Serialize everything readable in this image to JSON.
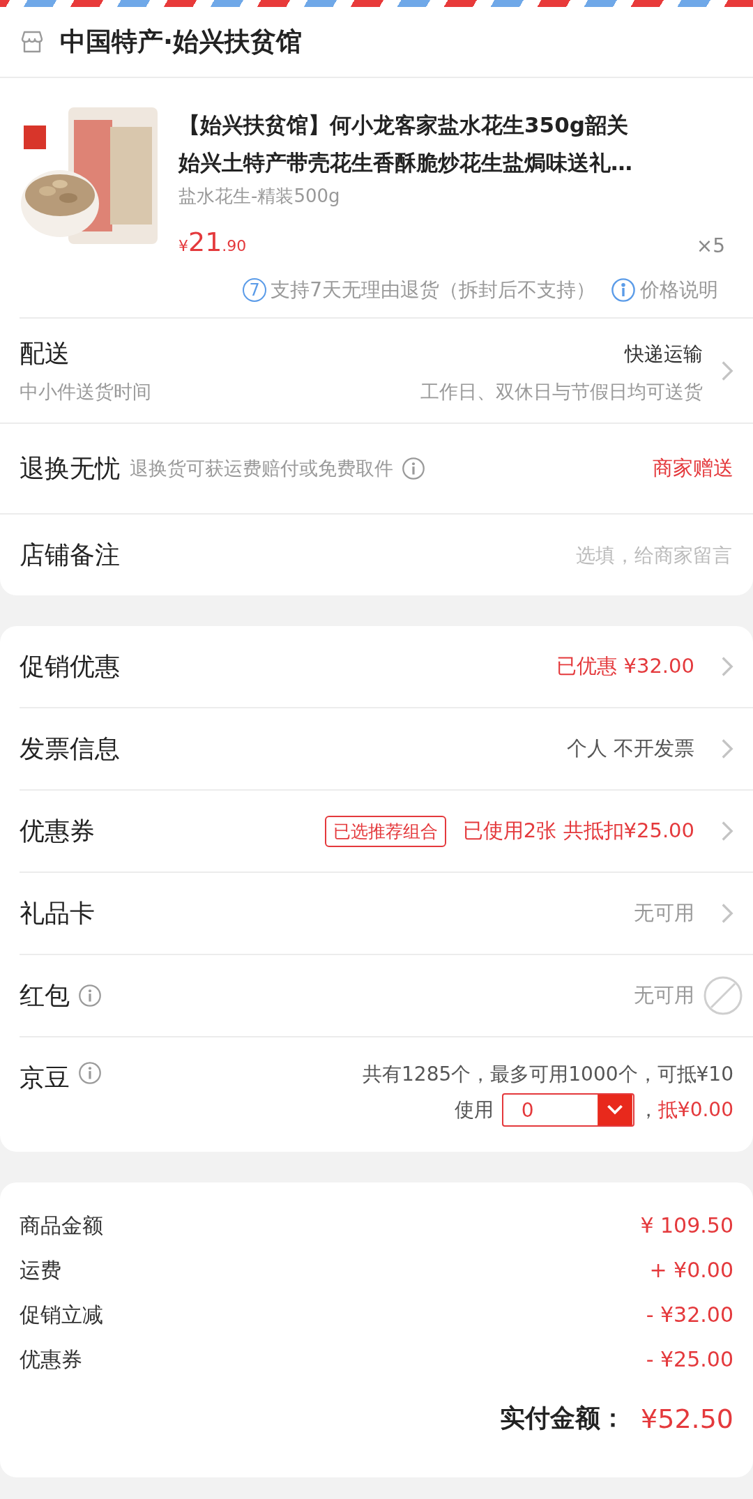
{
  "store": {
    "name": "中国特产·始兴扶贫馆"
  },
  "product": {
    "kind": "picture",
    "title": "【始兴扶贫馆】何小龙客家盐水花生350g韶关始兴土特产带壳花生香酥脆炒花生盐焗味送礼…",
    "spec": "盐水花生-精装500g",
    "price": {
      "currency": "¥",
      "integer": "21",
      "decimal": ".90"
    },
    "quantity": "×5",
    "services": [
      {
        "kind": "badge",
        "badge": "7",
        "text": "支持7天无理由退货（拆封后不支持）"
      },
      {
        "kind": "info",
        "text": "价格说明"
      }
    ]
  },
  "delivery": {
    "title": "配送",
    "subtitle": "中小件送货时间",
    "value": "快递运输",
    "detail": "工作日、双休日与节假日均可送货"
  },
  "returns": {
    "title": "退换无忧",
    "description": "退换货可获运费赔付或免费取件",
    "value": "商家赠送"
  },
  "note": {
    "label": "店铺备注",
    "placeholder": "选填，给商家留言"
  },
  "options": [
    {
      "kind": "arrow",
      "label": "促销优惠",
      "info": false,
      "value": "已优惠 ¥32.00",
      "emphasis": true
    },
    {
      "kind": "arrow",
      "label": "发票信息",
      "info": false,
      "value": "个人 不开发票",
      "emphasis": false
    },
    {
      "kind": "arrow",
      "label": "优惠券",
      "info": false,
      "tag": "已选推荐组合",
      "value": "已使用2张 共抵扣¥25.00",
      "emphasis": true
    },
    {
      "kind": "arrow",
      "label": "礼品卡",
      "info": false,
      "value": "无可用",
      "emphasis": false
    },
    {
      "kind": "disabled",
      "label": "红包",
      "info": true,
      "value": "无可用",
      "emphasis": false
    },
    {
      "kind": "beans",
      "label": "京豆",
      "info": true,
      "summary": "共有1285个，最多可用1000个，可抵¥10",
      "use_label": "使用",
      "amount": "0",
      "separator": "，",
      "deduction": "抵¥0.00"
    }
  ],
  "summary": {
    "lines": [
      {
        "label": "商品金额",
        "amount": "¥ 109.50"
      },
      {
        "label": "运费",
        "amount": "+ ¥0.00"
      },
      {
        "label": "促销立减",
        "amount": "- ¥32.00"
      },
      {
        "label": "优惠券",
        "amount": "- ¥25.00"
      }
    ],
    "total_label": "实付金额：",
    "total": "¥52.50"
  }
}
